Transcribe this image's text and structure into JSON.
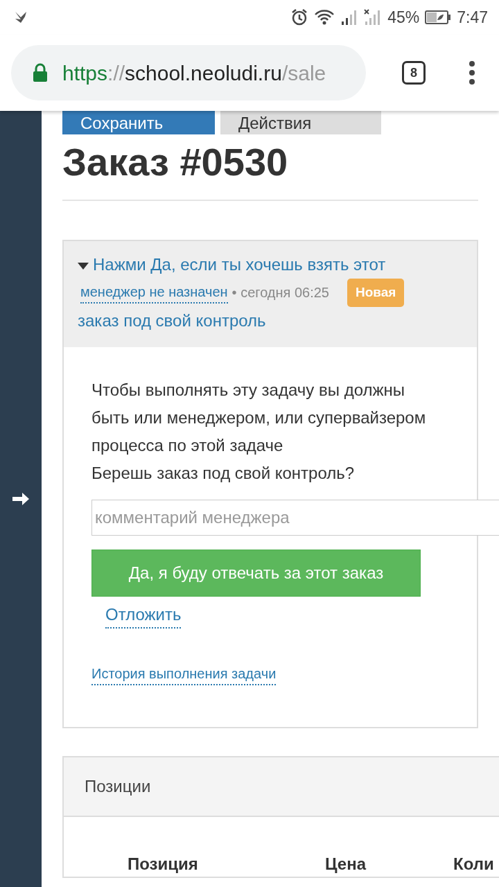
{
  "status_bar": {
    "battery": "45%",
    "time": "7:47"
  },
  "browser": {
    "url": [
      {
        "text": "https",
        "kind": "scheme"
      },
      {
        "text": "://",
        "kind": "muted"
      },
      {
        "text": "school.neoludi.ru",
        "kind": "host"
      },
      {
        "text": "/sale",
        "kind": "muted"
      }
    ],
    "tab_count": "8"
  },
  "toolbar": {
    "buttons": [
      {
        "label": "Сохранить",
        "kind": "primary"
      },
      {
        "label": "Действия",
        "kind": "secondary"
      }
    ]
  },
  "title": "Заказ #0530",
  "task": {
    "expanded": true,
    "title_lines": [
      "Нажми Да, если ты хочешь взять этот",
      "заказ под свой контроль"
    ],
    "manager": "менеджер не назначен",
    "time": "• сегодня 06:25",
    "badge": "Новая",
    "message": [
      "Чтобы выполнять эту задачу вы должны быть или менеджером, или супервайзером процесса по этой задаче",
      "Берешь заказ под свой контроль?"
    ],
    "comment": {
      "placeholder": "комментарий менеджера"
    },
    "confirm_button": "Да, я буду отвечать за этот заказ",
    "postpone_link": "Отложить",
    "history_link": "История выполнения задачи"
  },
  "positions": {
    "title": "Позиции",
    "columns": [
      "Позиция",
      "Цена",
      "Коли"
    ]
  }
}
